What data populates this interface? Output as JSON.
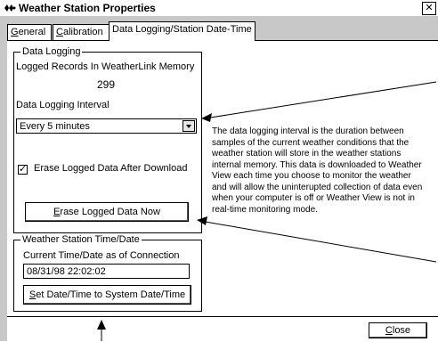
{
  "window": {
    "title": "Weather Station Properties",
    "close_glyph": "✕"
  },
  "tabs": [
    {
      "label_pre": "",
      "label_u": "G",
      "label_post": "eneral"
    },
    {
      "label_pre": "",
      "label_u": "C",
      "label_post": "alibration"
    },
    {
      "label": "Data Logging/Station Date-Time"
    }
  ],
  "data_logging": {
    "legend": "Data Logging",
    "records_label": "Logged Records In WeatherLink Memory",
    "records_value": "299",
    "interval_label": "Data Logging Interval",
    "interval_value": "Every 5 minutes",
    "erase_checkbox_label": "Erase Logged Data After Download",
    "erase_checked": true,
    "erase_button_u": "E",
    "erase_button_rest": "rase Logged Data Now"
  },
  "station_time": {
    "legend": "Weather Station Time/Date",
    "current_label": "Current Time/Date as of Connection",
    "current_value": "08/31/98 22:02:02",
    "set_button_u": "S",
    "set_button_rest": "et Date/Time to System Date/Time"
  },
  "explanation": "The data logging interval is the duration between samples of the current weather conditions that the weather station will store in the weather stations internal memory.  This data is downloaded to Weather View each time you choose to monitor the weather and will allow the uninterupted collection of data even when your computer is off or Weather View is not in real-time monitoring mode.",
  "footer": {
    "close_u": "C",
    "close_rest": "lose"
  },
  "icons": {
    "title_icon": "weather-app-icon",
    "dropdown": "chevron-down-icon"
  }
}
